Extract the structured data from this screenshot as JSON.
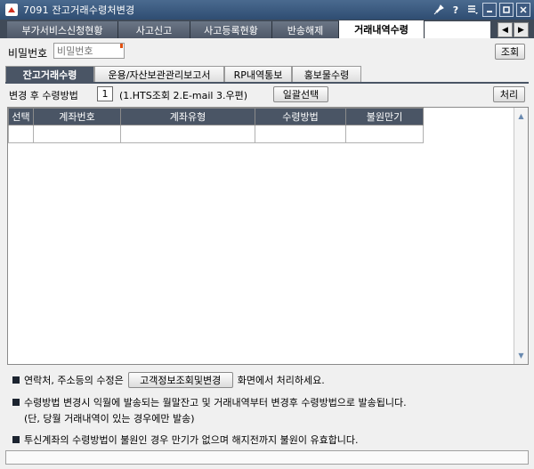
{
  "window": {
    "title": "7091 잔고거래수령처변경",
    "controls": [
      "pin-icon",
      "help-icon",
      "menu-icon",
      "minimize-icon",
      "maximize-icon",
      "close-icon"
    ]
  },
  "top_tabs": [
    {
      "label": "부가서비스신청현황",
      "active": false
    },
    {
      "label": "사고신고",
      "active": false
    },
    {
      "label": "사고등록현황",
      "active": false
    },
    {
      "label": "반송해제",
      "active": false
    },
    {
      "label": "거래내역수령",
      "active": true
    }
  ],
  "password": {
    "label": "비밀번호",
    "placeholder": "비밀번호",
    "value": ""
  },
  "buttons": {
    "inquiry": "조회",
    "process": "처리",
    "batch_select": "일괄선택",
    "customer_info": "고객정보조회및변경"
  },
  "sub_tabs": [
    {
      "label": "잔고거래수령",
      "active": true
    },
    {
      "label": "운용/자산보관관리보고서",
      "active": false
    },
    {
      "label": "RP내역통보",
      "active": false
    },
    {
      "label": "홍보물수령",
      "active": false
    }
  ],
  "change_method": {
    "label": "변경 후 수령방법",
    "value": "1",
    "hint": "(1.HTS조회 2.E-mail 3.우편)"
  },
  "grid": {
    "columns": [
      "선택",
      "계좌번호",
      "계좌유형",
      "수령방법",
      "불원만기"
    ],
    "rows": [
      [
        "",
        "",
        "",
        "",
        ""
      ]
    ]
  },
  "notes": {
    "note1_pre": "연락처, 주소등의 수정은",
    "note1_post": "화면에서 처리하세요.",
    "note2": "수령방법 변경시 익월에 발송되는 월말잔고 및 거래내역부터 변경후 수령방법으로 발송됩니다.",
    "note2_sub": "(단, 당월 거래내역이 있는 경우에만 발송)",
    "note3": "투신계좌의 수령방법이 불원인 경우 만기가 없으며 해지전까지 불원이 유효합니다."
  },
  "colors": {
    "dark_header": "#4a5565",
    "title_bar": "#3b5a80",
    "accent_mark": "#e05010"
  }
}
